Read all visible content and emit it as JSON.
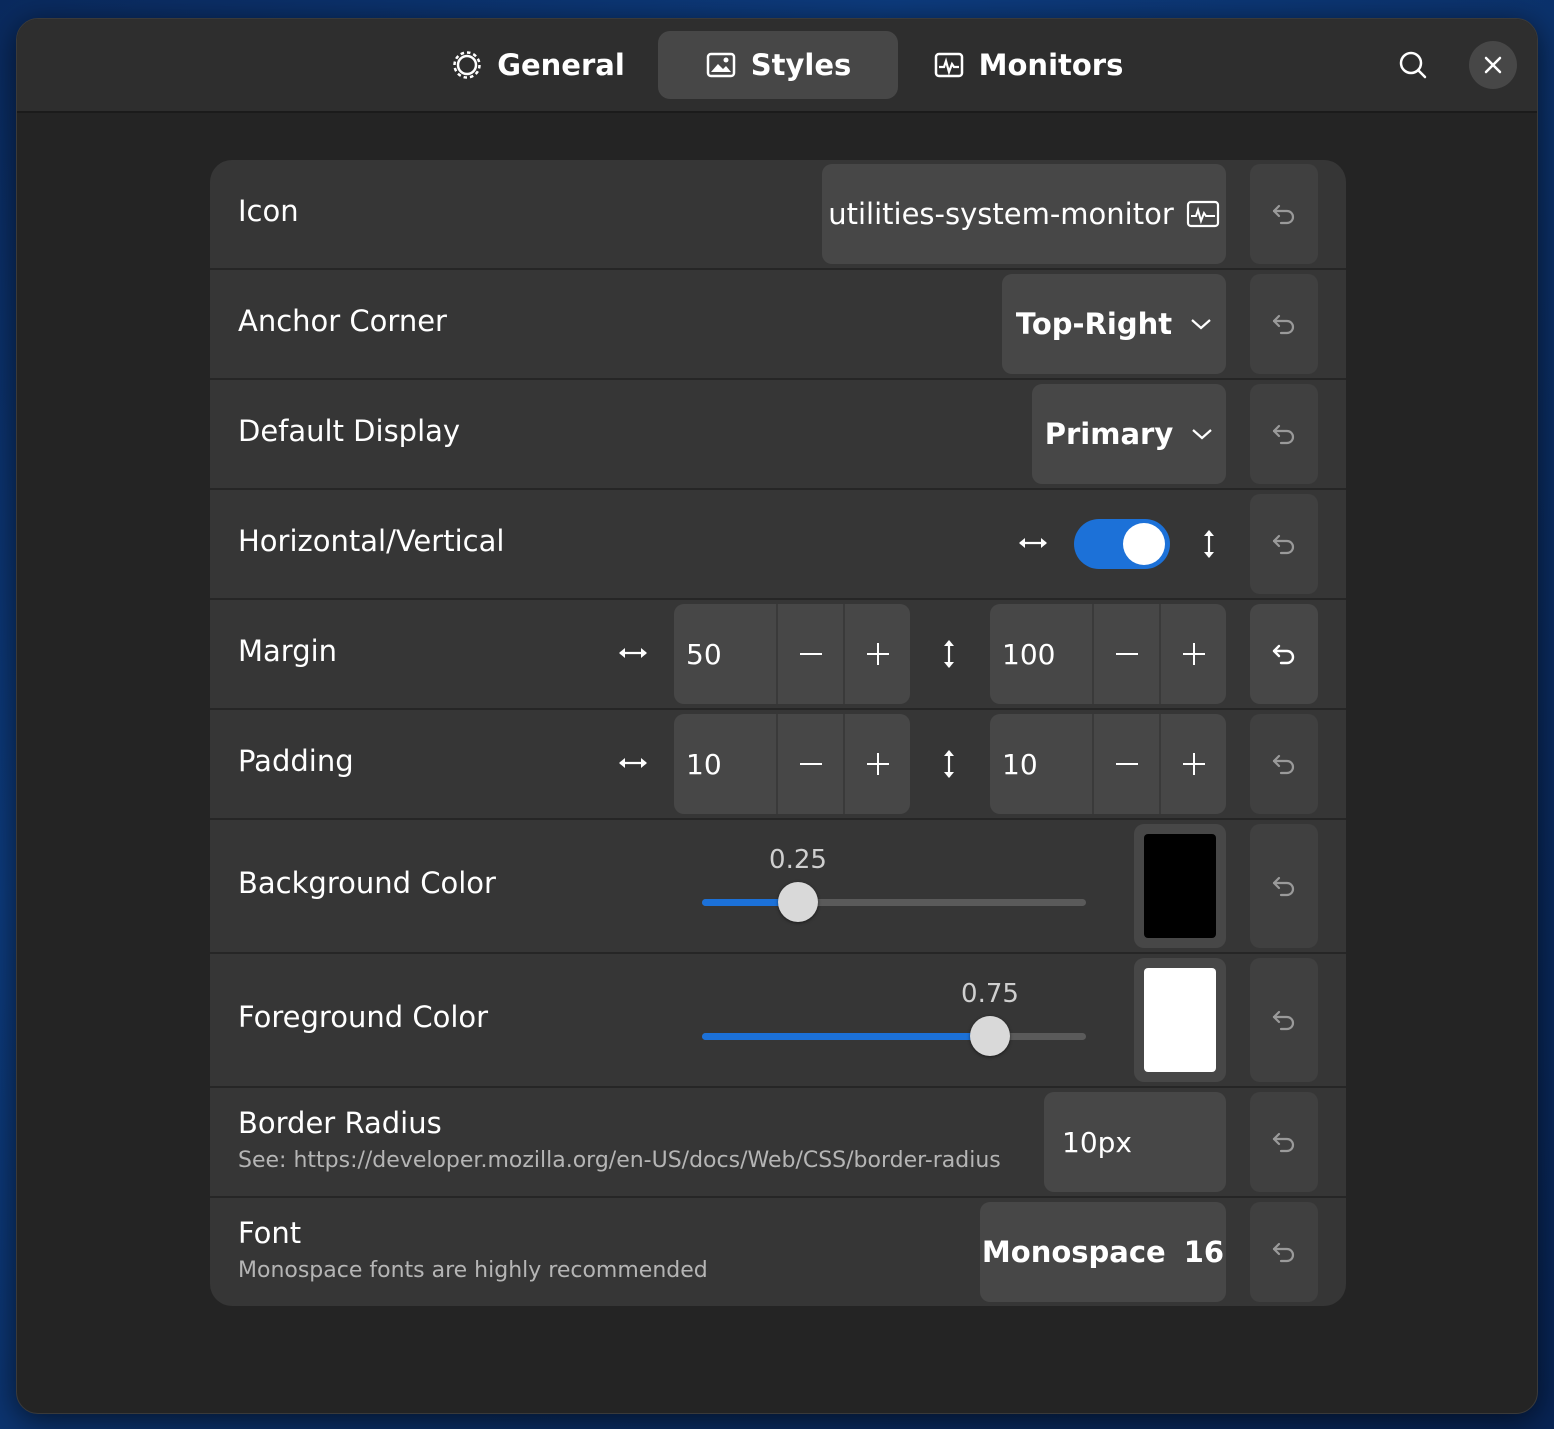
{
  "tabs": [
    {
      "label": "General",
      "icon": "gear-icon"
    },
    {
      "label": "Styles",
      "icon": "image-icon",
      "active": true
    },
    {
      "label": "Monitors",
      "icon": "monitor-graph-icon"
    }
  ],
  "header": {
    "search_icon": "search-icon",
    "close_icon": "close-icon"
  },
  "rows": {
    "icon": {
      "label": "Icon",
      "value": "utilities-system-monitor"
    },
    "anchor": {
      "label": "Anchor Corner",
      "value": "Top-Right"
    },
    "display": {
      "label": "Default Display",
      "value": "Primary"
    },
    "orientation": {
      "label": "Horizontal/Vertical",
      "checked": true
    },
    "margin": {
      "label": "Margin",
      "horizontal": "50",
      "vertical": "100"
    },
    "padding": {
      "label": "Padding",
      "horizontal": "10",
      "vertical": "10"
    },
    "background": {
      "label": "Background Color",
      "opacity": "0.25",
      "opacity_value": 0.25,
      "color": "#000000"
    },
    "foreground": {
      "label": "Foreground Color",
      "opacity": "0.75",
      "opacity_value": 0.75,
      "color": "#ffffff"
    },
    "radius": {
      "label": "Border Radius",
      "sublabel": "See: https://developer.mozilla.org/en-US/docs/Web/CSS/border-radius",
      "value": "10px"
    },
    "font": {
      "label": "Font",
      "sublabel": "Monospace fonts are highly recommended",
      "family": "Monospace",
      "size": "16"
    }
  },
  "colors": {
    "accent": "#1c71d8",
    "window_bg": "#242424",
    "card_bg": "#363636",
    "button_bg": "#474747"
  }
}
